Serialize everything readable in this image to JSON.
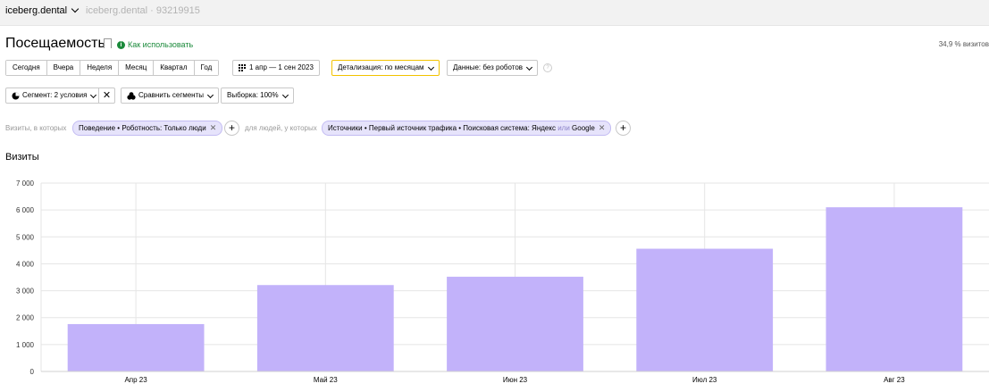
{
  "header": {
    "counter_name": "iceberg.dental",
    "counter_id": "iceberg.dental · 93219915"
  },
  "report": {
    "title": "Посещаемость",
    "how_to_use": "Как использовать",
    "sampling_info": "34,9 % визитов"
  },
  "period": {
    "buttons": [
      "Сегодня",
      "Вчера",
      "Неделя",
      "Месяц",
      "Квартал",
      "Год"
    ],
    "range_label": "1 апр — 1 сен 2023"
  },
  "controls": {
    "detail_label": "Детализация: по месяцам",
    "data_label": "Данные: без роботов",
    "segment_label": "Сегмент: 2 условия",
    "compare_label": "Сравнить сегменты",
    "sample_label": "Выборка: 100%"
  },
  "filters": {
    "visits_label": "Визиты, в которых",
    "visits_chip": "Поведение • Роботность: Только люди",
    "people_label": "для людей, у которых",
    "people_chip_text": "Источники • Первый источник трафика • Поисковая система: Яндекс",
    "people_chip_or": "или",
    "people_chip_tail": "Google"
  },
  "colors": {
    "bar": "#c2b2fa",
    "grid": "#e5e5e5",
    "accent_green": "#1b8a3b",
    "chip_bg": "#e6e3fb"
  },
  "chart_data": {
    "type": "bar",
    "title": "Визиты",
    "categories": [
      "Апр 23",
      "Май 23",
      "Июн 23",
      "Июл 23",
      "Авг 23"
    ],
    "values": [
      1760,
      3210,
      3520,
      4560,
      6100
    ],
    "ylim": [
      0,
      7000
    ],
    "yticks": [
      "0",
      "1 000",
      "2 000",
      "3 000",
      "4 000",
      "5 000",
      "6 000",
      "7 000"
    ],
    "grid": true
  }
}
